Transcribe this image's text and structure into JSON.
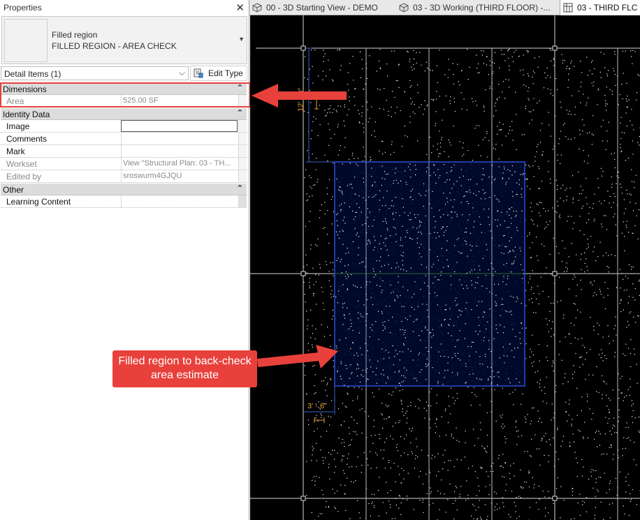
{
  "properties": {
    "title": "Properties",
    "close_glyph": "✕",
    "type_selector": {
      "family": "Filled region",
      "type": "FILLED REGION - AREA CHECK"
    },
    "filter": {
      "label": "Detail Items (1)",
      "edit_type_label": "Edit Type"
    },
    "categories": {
      "dimensions": {
        "label": "Dimensions",
        "rows": [
          {
            "key": "Area",
            "value": "525.00 SF"
          }
        ]
      },
      "identity": {
        "label": "Identity Data",
        "rows": [
          {
            "key": "Image",
            "value": ""
          },
          {
            "key": "Comments",
            "value": ""
          },
          {
            "key": "Mark",
            "value": ""
          },
          {
            "key": "Workset",
            "value": "View \"Structural Plan: 03 - TH..."
          },
          {
            "key": "Edited by",
            "value": "sroswurm4GJQU"
          }
        ]
      },
      "other": {
        "label": "Other",
        "rows": [
          {
            "key": "Learning Content",
            "value": ""
          }
        ]
      }
    }
  },
  "tabs": [
    {
      "label": "00 - 3D Starting View - DEMO",
      "icon": "3d-view-icon"
    },
    {
      "label": "03 - 3D Working (THIRD FLOOR) -...",
      "icon": "3d-view-icon"
    },
    {
      "label": "03 - THIRD FLC",
      "icon": "plan-view-icon"
    }
  ],
  "canvas": {
    "dimension_vertical": "12' - 0\"",
    "dimension_horizontal": "3' - 6\""
  },
  "callout": {
    "text": "Filled region to back-check area estimate",
    "color": "#e8413c"
  },
  "colors": {
    "accent": "#e8413c",
    "region_fill": "#000a30",
    "region_edge": "#1f3ca8",
    "dimension": "#e8a23c"
  }
}
